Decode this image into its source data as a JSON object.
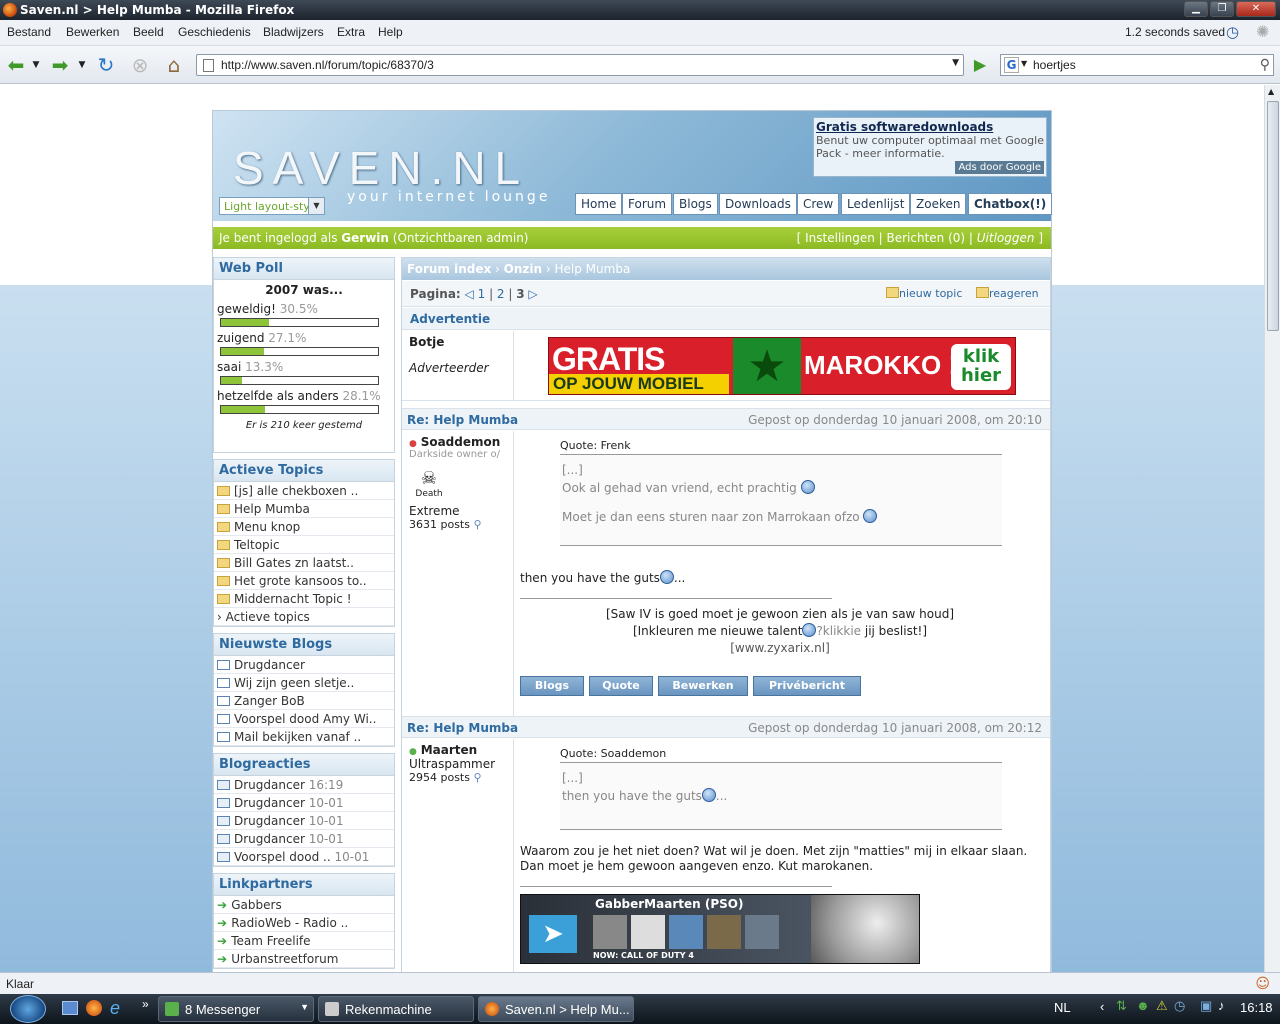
{
  "window": {
    "title": "Saven.nl > Help Mumba - Mozilla Firefox"
  },
  "menu": [
    "Bestand",
    "Bewerken",
    "Beeld",
    "Geschiedenis",
    "Bladwijzers",
    "Extra",
    "Help"
  ],
  "session": {
    "saved": "1.2 seconds saved"
  },
  "nav": {
    "url": "http://www.saven.nl/forum/topic/68370/3",
    "search": "hoertjes"
  },
  "site": {
    "logo": "SAVEN.NL",
    "tagline": "your internet lounge",
    "layout_select": "Light layout-style",
    "ad": {
      "title": "Gratis softwaredownloads",
      "text": "Benut uw computer optimaal met Google Pack - meer informatie.",
      "by": "Ads door Google"
    },
    "topnav": [
      "Home",
      "Forum",
      "Blogs",
      "Downloads",
      "Crew",
      "Ledenlijst",
      "Zoeken",
      "Chatbox(!)"
    ],
    "login": {
      "prefix": "Je bent ingelogd als",
      "user": "Gerwin",
      "suffix": "(Ontzichtbaren admin)",
      "links": [
        "Instellingen",
        "Berichten (0)",
        "Uitloggen"
      ]
    }
  },
  "poll": {
    "title": "Web Poll",
    "question": "2007 was...",
    "options": [
      {
        "label": "geweldig!",
        "pct": "30.5%",
        "value": 0.305
      },
      {
        "label": "zuigend",
        "pct": "27.1%",
        "value": 0.271
      },
      {
        "label": "saai",
        "pct": "13.3%",
        "value": 0.133
      },
      {
        "label": "hetzelfde als anders",
        "pct": "28.1%",
        "value": 0.281
      }
    ],
    "votes": "Er is 210 keer gestemd"
  },
  "active_topics": {
    "title": "Actieve Topics",
    "items": [
      "[js] alle chekboxen ..",
      "Help Mumba",
      "Menu knop",
      "Teltopic",
      "Bill Gates zn laatst..",
      "Het grote kansoos to..",
      "Middernacht Topic !"
    ],
    "more": "Actieve topics"
  },
  "blogs": {
    "title": "Nieuwste Blogs",
    "items": [
      "Drugdancer",
      "Wij zijn geen sletje..",
      "Zanger BoB",
      "Voorspel dood Amy Wi..",
      "Mail bekijken vanaf .."
    ]
  },
  "reactions": {
    "title": "Blogreacties",
    "items": [
      {
        "name": "Drugdancer",
        "time": "16:19"
      },
      {
        "name": "Drugdancer",
        "time": "10-01"
      },
      {
        "name": "Drugdancer",
        "time": "10-01"
      },
      {
        "name": "Drugdancer",
        "time": "10-01"
      },
      {
        "name": "Voorspel dood ..",
        "time": "10-01"
      }
    ]
  },
  "links": {
    "title": "Linkpartners",
    "items": [
      "Gabbers",
      "RadioWeb - Radio ..",
      "Team Freelife",
      "Urbanstreetforum"
    ]
  },
  "forum": {
    "crumb": [
      "Forum index",
      "Onzin",
      "Help Mumba"
    ],
    "pagination": {
      "label": "Pagina:",
      "pages": [
        "1",
        "2",
        "3"
      ],
      "current": "3"
    },
    "actions": [
      "nieuw topic",
      "reageren"
    ],
    "ad_section": "Advertentie",
    "advertiser": {
      "name": "Botje",
      "role": "Adverteerder"
    },
    "banner": {
      "big": "GRATIS",
      "sub": "OP JOUW MOBIEL",
      "country": "MAROKKO !",
      "cta1": "klik",
      "cta2": "hier"
    },
    "posts": [
      {
        "title": "Re: Help Mumba",
        "date": "Gepost op donderdag 10 januari 2008, om 20:10",
        "user": "Soaddemon",
        "subtitle": "Darkside owner o/",
        "avatar_text": "Death",
        "rank": "Extreme",
        "posts": "3631 posts",
        "quote_label": "Quote: Frenk",
        "quote_lines": [
          "[...]",
          "Ook al gehad van vriend, echt prachtig",
          "Moet je dan eens sturen naar zon Marrokaan ofzo"
        ],
        "body": "then you have the guts",
        "body_end": "...",
        "sig1": "[Saw IV is goed moet je gewoon zien als je van saw houd]",
        "sig2a": "[Inkleuren me nieuwe talent",
        "sig2b": "?klikkie",
        "sig2c": " jij beslist!]",
        "sig3": "[www.zyxarix.nl]",
        "buttons": [
          "Blogs",
          "Quote",
          "Bewerken",
          "Privébericht"
        ]
      },
      {
        "title": "Re: Help Mumba",
        "date": "Gepost op donderdag 10 januari 2008, om 20:12",
        "user": "Maarten",
        "rank": "Ultraspammer",
        "posts": "2954 posts",
        "quote_label": "Quote: Soaddemon",
        "quote_lines": [
          "[...]",
          "then you have the guts",
          "..."
        ],
        "body": "Waarom zou je het niet doen? Wat wil je doen. Met zijn \"matties\" mij in elkaar slaan. Dan moet je hem gewoon aangeven enzo. Kut marokanen.",
        "banner_title": "GabberMaarten (PSO)",
        "banner_sub": "NOW: CALL OF DUTY 4"
      }
    ]
  },
  "status": "Klaar",
  "taskbar": {
    "items": [
      "8 Messenger",
      "Rekenmachine",
      "Saven.nl > Help Mu..."
    ],
    "lang": "NL",
    "time": "16:18"
  },
  "colors": {
    "accent": "#2f6aa0",
    "green": "#8cba22",
    "banner_red": "#d9202a"
  }
}
